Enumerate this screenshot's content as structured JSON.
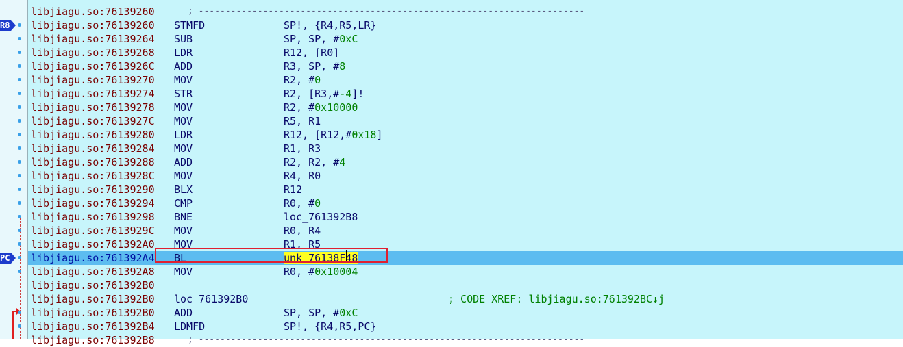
{
  "gutter": {
    "tags": [
      {
        "label": "R8",
        "row": 1
      },
      {
        "label": "PC",
        "row": 18
      }
    ]
  },
  "rows": [
    {
      "addr": "libjiagu.so:76139260",
      "type": "sep",
      "sep": "; ------------------------------------------------------------------------",
      "dot": false
    },
    {
      "addr": "libjiagu.so:76139260",
      "mnem": "STMFD",
      "ops": [
        {
          "t": "SP!, {R4,R5,LR}"
        }
      ],
      "dot": true
    },
    {
      "addr": "libjiagu.so:76139264",
      "mnem": "SUB",
      "ops": [
        {
          "t": "SP, SP, #"
        },
        {
          "t": "0xC",
          "n": true
        }
      ],
      "dot": true
    },
    {
      "addr": "libjiagu.so:76139268",
      "mnem": "LDR",
      "ops": [
        {
          "t": "R12, [R0]"
        }
      ],
      "dot": true
    },
    {
      "addr": "libjiagu.so:7613926C",
      "mnem": "ADD",
      "ops": [
        {
          "t": "R3, SP, #"
        },
        {
          "t": "8",
          "n": true
        }
      ],
      "dot": true
    },
    {
      "addr": "libjiagu.so:76139270",
      "mnem": "MOV",
      "ops": [
        {
          "t": "R2, #"
        },
        {
          "t": "0",
          "n": true
        }
      ],
      "dot": true
    },
    {
      "addr": "libjiagu.so:76139274",
      "mnem": "STR",
      "ops": [
        {
          "t": "R2, [R3,#"
        },
        {
          "t": "-4",
          "n": true
        },
        {
          "t": "]!"
        }
      ],
      "dot": true
    },
    {
      "addr": "libjiagu.so:76139278",
      "mnem": "MOV",
      "ops": [
        {
          "t": "R2, #"
        },
        {
          "t": "0x10000",
          "n": true
        }
      ],
      "dot": true
    },
    {
      "addr": "libjiagu.so:7613927C",
      "mnem": "MOV",
      "ops": [
        {
          "t": "R5, R1"
        }
      ],
      "dot": true
    },
    {
      "addr": "libjiagu.so:76139280",
      "mnem": "LDR",
      "ops": [
        {
          "t": "R12, [R12,#"
        },
        {
          "t": "0x18",
          "n": true
        },
        {
          "t": "]"
        }
      ],
      "dot": true
    },
    {
      "addr": "libjiagu.so:76139284",
      "mnem": "MOV",
      "ops": [
        {
          "t": "R1, R3"
        }
      ],
      "dot": true
    },
    {
      "addr": "libjiagu.so:76139288",
      "mnem": "ADD",
      "ops": [
        {
          "t": "R2, R2, #"
        },
        {
          "t": "4",
          "n": true
        }
      ],
      "dot": true
    },
    {
      "addr": "libjiagu.so:7613928C",
      "mnem": "MOV",
      "ops": [
        {
          "t": "R4, R0"
        }
      ],
      "dot": true
    },
    {
      "addr": "libjiagu.so:76139290",
      "mnem": "BLX",
      "ops": [
        {
          "t": "R12"
        }
      ],
      "dot": true
    },
    {
      "addr": "libjiagu.so:76139294",
      "mnem": "CMP",
      "ops": [
        {
          "t": "R0, #"
        },
        {
          "t": "0",
          "n": true
        }
      ],
      "dot": true
    },
    {
      "addr": "libjiagu.so:76139298",
      "mnem": "BNE",
      "ops": [
        {
          "t": "loc_761392B8"
        }
      ],
      "dot": true
    },
    {
      "addr": "libjiagu.so:7613929C",
      "mnem": "MOV",
      "ops": [
        {
          "t": "R0, R4"
        }
      ],
      "dot": true
    },
    {
      "addr": "libjiagu.so:761392A0",
      "mnem": "MOV",
      "ops": [
        {
          "t": "R1, R5"
        }
      ],
      "dot": true
    },
    {
      "addr": "libjiagu.so:761392A4",
      "mnem": "BL",
      "ops": [
        {
          "t": "unk_76138F48",
          "h": true
        }
      ],
      "dot": true,
      "current": true
    },
    {
      "addr": "libjiagu.so:761392A8",
      "mnem": "MOV",
      "ops": [
        {
          "t": "R0, #"
        },
        {
          "t": "0x10004",
          "n": true
        }
      ],
      "dot": true
    },
    {
      "addr": "libjiagu.so:761392B0",
      "mnem": "",
      "ops": [],
      "dot": false
    },
    {
      "addr": "libjiagu.so:761392B0",
      "type": "label",
      "label": "loc_761392B0",
      "comment": "; CODE XREF: libjiagu.so:761392BC↓j",
      "dot": false
    },
    {
      "addr": "libjiagu.so:761392B0",
      "mnem": "ADD",
      "ops": [
        {
          "t": "SP, SP, #"
        },
        {
          "t": "0xC",
          "n": true
        }
      ],
      "dot": true
    },
    {
      "addr": "libjiagu.so:761392B4",
      "mnem": "LDMFD",
      "ops": [
        {
          "t": "SP!, {R4,R5,PC}"
        }
      ],
      "dot": true
    },
    {
      "addr": "libjiagu.so:761392B8",
      "type": "sep",
      "sep": "; ------------------------------------------------------------------------",
      "dot": false
    }
  ]
}
